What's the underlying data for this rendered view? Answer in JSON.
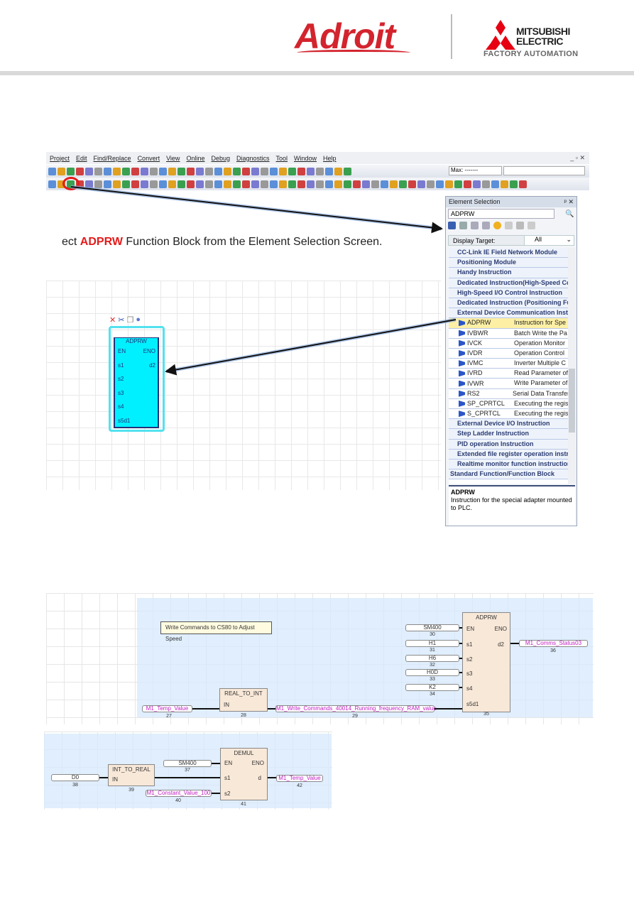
{
  "header": {
    "brand_logo": "Adroit",
    "partner_logo_line1": "MITSUBISHI",
    "partner_logo_line2": "ELECTRIC",
    "partner_logo_tagline": "FACTORY AUTOMATION"
  },
  "menu": [
    "Project",
    "Edit",
    "Find/Replace",
    "Convert",
    "View",
    "Online",
    "Debug",
    "Diagnostics",
    "Tool",
    "Window",
    "Help"
  ],
  "window_controls": "_ ▫ ✕",
  "toolbar": {
    "monitor_label": "Max: -------"
  },
  "instruction": {
    "prefix": "ect ",
    "keyword": "ADPRW",
    "suffix": " Function Block from the Element Selection Screen."
  },
  "element_selection": {
    "title": "Element Selection",
    "pin": "ᵖ ✕",
    "search_value": "ADPRW",
    "display_target_label": "Display Target:",
    "display_target_value": "All",
    "rows": [
      {
        "type": "cat",
        "label": "CC-Link IE Field Network Module"
      },
      {
        "type": "cat",
        "label": "Positioning Module"
      },
      {
        "type": "cat",
        "label": "Handy Instruction"
      },
      {
        "type": "cat",
        "label": "Dedicated Instruction(High-Speed Co"
      },
      {
        "type": "cat",
        "label": "High-Speed I/O Control Instruction"
      },
      {
        "type": "cat",
        "label": "Dedicated Instruction (Positioning Fu"
      },
      {
        "type": "cat",
        "label": "External Device Communication Instr"
      },
      {
        "type": "item",
        "name": "ADPRW",
        "desc": "Instruction for Spe",
        "selected": true
      },
      {
        "type": "item",
        "name": "IVBWR",
        "desc": "Batch Write the Pa"
      },
      {
        "type": "item",
        "name": "IVCK",
        "desc": "Operation Monitor"
      },
      {
        "type": "item",
        "name": "IVDR",
        "desc": "Operation Control"
      },
      {
        "type": "item",
        "name": "IVMC",
        "desc": "Inverter Multiple C"
      },
      {
        "type": "item",
        "name": "IVRD",
        "desc": "Read Parameter of"
      },
      {
        "type": "item",
        "name": "IVWR",
        "desc": "Write Parameter of"
      },
      {
        "type": "item",
        "name": "RS2",
        "desc": "Serial Data Transfer"
      },
      {
        "type": "item",
        "name": "SP_CPRTCL",
        "desc": "Executing the regis"
      },
      {
        "type": "item",
        "name": "S_CPRTCL",
        "desc": "Executing the regis"
      },
      {
        "type": "cat",
        "label": "External Device I/O Instruction"
      },
      {
        "type": "cat",
        "label": "Step Ladder Instruction"
      },
      {
        "type": "cat",
        "label": "PID operation Instruction"
      },
      {
        "type": "cat",
        "label": "Extended file register operation instr"
      },
      {
        "type": "cat",
        "label": "Realtime monitor function instruction"
      },
      {
        "type": "std",
        "label": "Standard Function/Function Block"
      }
    ],
    "desc_title": "ADPRW",
    "desc_text": "Instruction for the special adapter mounted to PLC."
  },
  "fb_preview": {
    "title": "ADPRW",
    "inputs": [
      "EN",
      "s1",
      "s2",
      "s3",
      "s4",
      "s5d1"
    ],
    "outputs": [
      "ENO",
      "d2"
    ]
  },
  "diagram1": {
    "comment": "Write Commands to CS80 to Adjust Speed",
    "adprw": {
      "title": "ADPRW",
      "pins": [
        "EN",
        "s1",
        "s2",
        "s3",
        "s4",
        "s5d1"
      ],
      "outs": [
        "ENO",
        "d2"
      ],
      "num": "35"
    },
    "inputs": [
      {
        "v": "SM400",
        "n": "30"
      },
      {
        "v": "H1",
        "n": "31"
      },
      {
        "v": "H6",
        "n": "32"
      },
      {
        "v": "H0D",
        "n": "33"
      },
      {
        "v": "K2",
        "n": "34"
      }
    ],
    "output": {
      "v": "M1_Comms_Status03",
      "n": "36"
    },
    "temp": {
      "v": "M1_Temp_Value",
      "n": "27"
    },
    "real_to_int": {
      "title": "REAL_TO_INT",
      "pin": "IN",
      "num": "28"
    },
    "write_cmd": {
      "v": "M1_Write_Commands_40014_Running_frequency_RAM_value",
      "n": "29"
    }
  },
  "diagram2": {
    "d0": {
      "v": "D0",
      "n": "38"
    },
    "int_to_real": {
      "title": "INT_TO_REAL",
      "pin": "IN",
      "num": "39"
    },
    "sm400": {
      "v": "SM400",
      "n": "37"
    },
    "const": {
      "v": "M1_Constant_Value_100",
      "n": "40"
    },
    "demul": {
      "title": "DEMUL",
      "pins": [
        "EN",
        "s1",
        "s2"
      ],
      "outs": [
        "ENO",
        "d"
      ],
      "num": "41"
    },
    "out": {
      "v": "M1_Temp_Value",
      "n": "42"
    }
  },
  "colors": {
    "accent_red": "#e41b1b",
    "brand_red": "#d3242e",
    "fb_cyan": "#00f0ff",
    "fb_beige": "#f8e8d8",
    "variable_magenta": "#c020c0"
  }
}
